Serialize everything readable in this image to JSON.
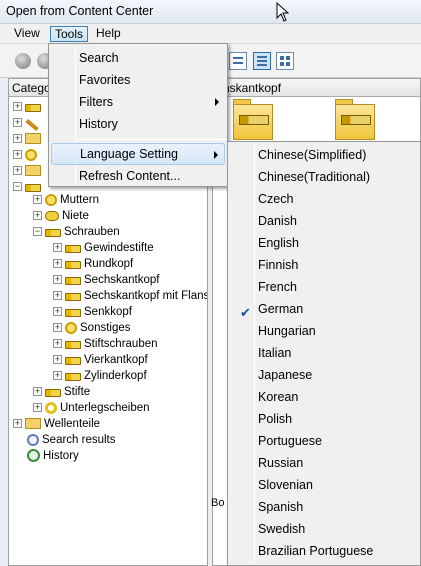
{
  "window": {
    "title": "Open from Content Center"
  },
  "menubar": {
    "view": "View",
    "tools": "Tools",
    "help": "Help"
  },
  "tree": {
    "header": "Catego",
    "items": [
      {
        "label": "Muttern"
      },
      {
        "label": "Niete"
      },
      {
        "label": "Schrauben"
      },
      {
        "label": "Gewindestifte"
      },
      {
        "label": "Rundkopf"
      },
      {
        "label": "Sechskantkopf"
      },
      {
        "label": "Sechskantkopf mit Flansch"
      },
      {
        "label": "Senkkopf"
      },
      {
        "label": "Sonstiges"
      },
      {
        "label": "Stiftschrauben"
      },
      {
        "label": "Vierkantkopf"
      },
      {
        "label": "Zylinderkopf"
      },
      {
        "label": "Stifte"
      },
      {
        "label": "Unterlegscheiben"
      },
      {
        "label": "Wellenteile"
      },
      {
        "label": "Search results"
      },
      {
        "label": "History"
      }
    ]
  },
  "right_panel": {
    "header": "chskantkopf",
    "partial_label": "Bo"
  },
  "tools_menu": {
    "items": [
      {
        "label": "Search"
      },
      {
        "label": "Favorites"
      },
      {
        "label": "Filters"
      },
      {
        "label": "History"
      },
      {
        "label": "Language Setting"
      },
      {
        "label": "Refresh Content..."
      }
    ]
  },
  "language_menu": {
    "selected": "German",
    "items": [
      "Chinese(Simplified)",
      "Chinese(Traditional)",
      "Czech",
      "Danish",
      "English",
      "Finnish",
      "French",
      "German",
      "Hungarian",
      "Italian",
      "Japanese",
      "Korean",
      "Polish",
      "Portuguese",
      "Russian",
      "Slovenian",
      "Spanish",
      "Swedish",
      "Brazilian Portuguese"
    ]
  },
  "colors": {
    "accent": "#3c7fb1",
    "check": "#1a4e9e",
    "folder": "#f0c43a"
  }
}
